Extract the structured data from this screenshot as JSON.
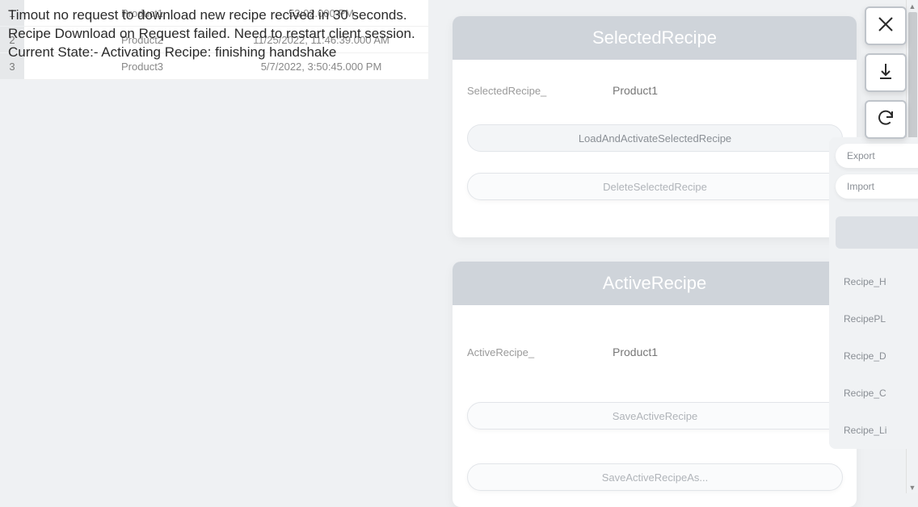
{
  "overlay": {
    "line1": "Timout no request to download new recipe recived in 30 seconds.",
    "line2": "Recipe Download on Request failed. Need to restart client session.",
    "line3": "Current State:- Activating Recipe: finishing handshake"
  },
  "table": {
    "rows": [
      {
        "num": "1",
        "name": "Product1",
        "date": "53:02.000 PM"
      },
      {
        "num": "2",
        "name": "Product2",
        "date": "11/25/2022, 11:46:39.000 AM"
      },
      {
        "num": "3",
        "name": "Product3",
        "date": "5/7/2022, 3:50:45.000 PM"
      }
    ]
  },
  "selected": {
    "title": "SelectedRecipe",
    "label": "SelectedRecipe_",
    "value": "Product1",
    "btn_load": "LoadAndActivateSelectedRecipe",
    "btn_delete": "DeleteSelectedRecipe"
  },
  "active": {
    "title": "ActiveRecipe",
    "label": "ActiveRecipe_",
    "value": "Product1",
    "btn_save": "SaveActiveRecipe",
    "btn_saveas": "SaveActiveRecipeAs..."
  },
  "side": {
    "export": "Export",
    "import": "Import",
    "items": [
      "Recipe_H",
      "RecipePL",
      "Recipe_D",
      "Recipe_C",
      "Recipe_Li"
    ]
  }
}
